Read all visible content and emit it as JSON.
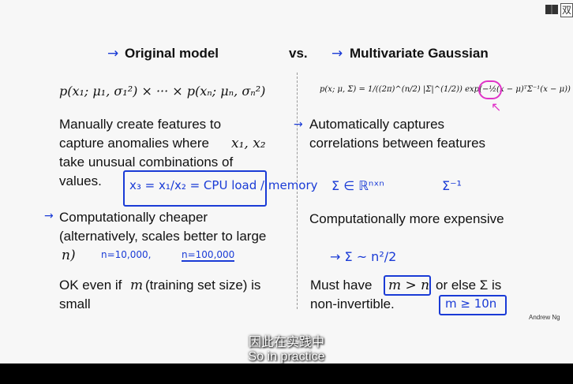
{
  "headers": {
    "left": "Original model",
    "vs": "vs.",
    "right": "Multivariate Gaussian"
  },
  "formulas": {
    "left": "p(x₁; μ₁, σ₁²) × ··· × p(xₙ; μₙ, σₙ²)",
    "right": "p(x; μ, Σ) = 1/((2π)^(n/2) |Σ|^(1/2)) exp(−½(x − μ)ᵀΣ⁻¹(x − μ))"
  },
  "left": {
    "point1": [
      "Manually create features to",
      "capture anomalies where",
      "take unusual combinations of",
      "values."
    ],
    "point1_math": "x₁, x₂",
    "point2": [
      "Computationally cheaper",
      "(alternatively, scales better to large"
    ],
    "point2_math": "n)",
    "point3": [
      "OK even if",
      "(training set size) is",
      "small"
    ],
    "point3_math": "m"
  },
  "right": {
    "point1": [
      "Automatically captures",
      "correlations between features"
    ],
    "point2": "Computationally more expensive",
    "point3": [
      "Must have",
      "or else Σ is",
      "non-invertible."
    ],
    "point3_math": "m > n"
  },
  "annotations": {
    "x3_feature": "x₃ = x₁/x₂ = CPU load / memory",
    "n_small": "n=10,000,",
    "n_large": "n=100,000",
    "sigma_dim": "Σ ∈ ℝⁿˣⁿ",
    "sigma_inv": "Σ⁻¹",
    "sigma_cost": "→ Σ   ~ n²/2",
    "m_rule": "m ≥ 10n"
  },
  "credit": "Andrew Ng",
  "subtitles": {
    "zh": "因此在实践中",
    "en": "So in practice"
  },
  "corner": {
    "label": "双"
  }
}
